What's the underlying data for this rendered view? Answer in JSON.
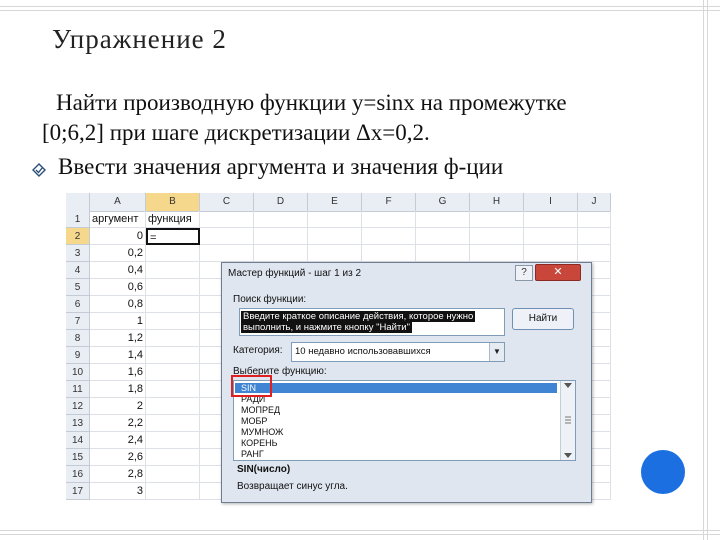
{
  "slide": {
    "title": "Упражнение 2",
    "line1": "Найти производную функции y=sinx на промежутке",
    "line2": "[0;6,2] при шаге дискретизации Δx=0,2.",
    "bullet_text": "Ввести значения аргумента и значения ф-ции",
    "bullet_icon": "diamond-bullet-icon"
  },
  "sheet": {
    "columns": [
      "A",
      "B",
      "C",
      "D",
      "E",
      "F",
      "G",
      "H",
      "I",
      "J"
    ],
    "rows": [
      "1",
      "2",
      "3",
      "4",
      "5",
      "6",
      "7",
      "8",
      "9",
      "10",
      "11",
      "12",
      "13",
      "14",
      "15",
      "16",
      "17"
    ],
    "header_a": "аргумент",
    "header_b": "функция",
    "b2_value": "=",
    "a_values": [
      "0",
      "0,2",
      "0,4",
      "0,6",
      "0,8",
      "1",
      "1,2",
      "1,4",
      "1,6",
      "1,8",
      "2",
      "2,2",
      "2,4",
      "2,6",
      "2,8",
      "3"
    ]
  },
  "dialog": {
    "title": "Мастер функций - шаг 1 из 2",
    "help": "?",
    "close": "✕",
    "search_label": "Поиск функции:",
    "search_text_1": "Введите краткое описание действия, которое нужно",
    "search_text_2": "выполнить, и нажмите кнопку \"Найти\"",
    "find_button": "Найти",
    "category_label": "Категория:",
    "category_value": "10 недавно использовавшихся",
    "list_label": "Выберите функцию:",
    "functions": [
      "SIN",
      "РАДИ",
      "МОПРЕД",
      "МОБР",
      "МУМНОЖ",
      "КОРЕНЬ",
      "РАНГ"
    ],
    "signature": "SIN(число)",
    "description": "Возвращает синус угла."
  },
  "colors": {
    "accent_dot": "#1b6fe0",
    "selection": "#3f85d3",
    "highlight_box": "#e02020"
  }
}
